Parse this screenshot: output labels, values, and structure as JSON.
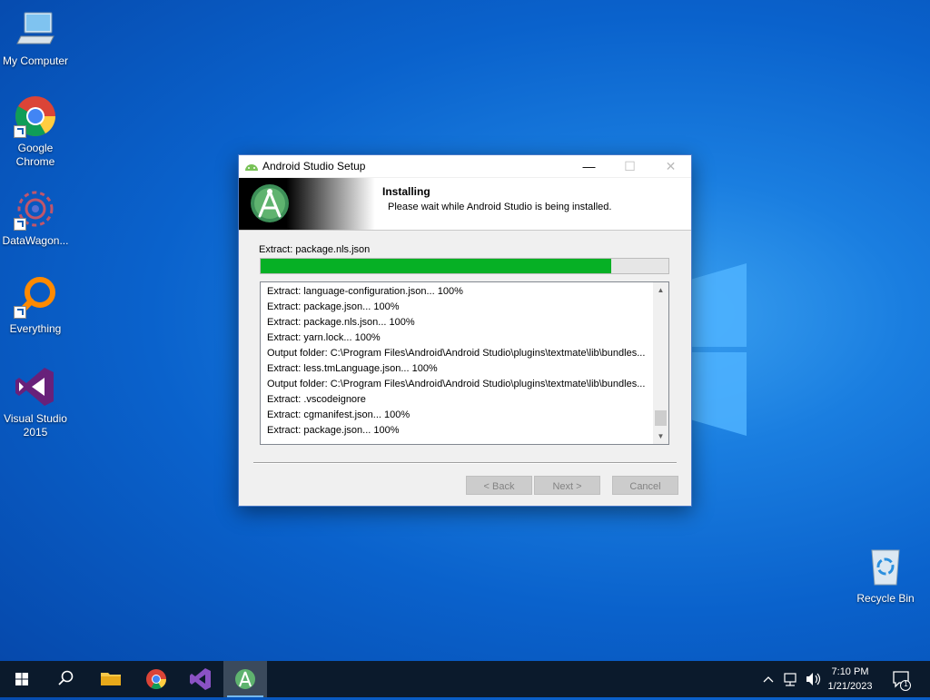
{
  "desktop": {
    "icons": [
      {
        "label": "My Computer"
      },
      {
        "label": "Google Chrome"
      },
      {
        "label": "DataWagon..."
      },
      {
        "label": "Everything"
      },
      {
        "label": "Visual Studio 2015"
      },
      {
        "label": "Recycle Bin"
      }
    ]
  },
  "dialog": {
    "title": "Android Studio Setup",
    "header_title": "Installing",
    "header_subtitle": "Please wait while Android Studio is being installed.",
    "status": "Extract: package.nls.json",
    "progress": 0.86,
    "log": [
      "Extract: language-configuration.json... 100%",
      "Extract: package.json... 100%",
      "Extract: package.nls.json... 100%",
      "Extract: yarn.lock... 100%",
      "Output folder: C:\\Program Files\\Android\\Android Studio\\plugins\\textmate\\lib\\bundles...",
      "Extract: less.tmLanguage.json... 100%",
      "Output folder: C:\\Program Files\\Android\\Android Studio\\plugins\\textmate\\lib\\bundles...",
      "Extract: .vscodeignore",
      "Extract: cgmanifest.json... 100%",
      "Extract: package.json... 100%"
    ],
    "buttons": {
      "back": "< Back",
      "next": "Next >",
      "cancel": "Cancel"
    }
  },
  "taskbar": {
    "items": [
      {
        "icon": "start-icon"
      },
      {
        "icon": "search-icon"
      },
      {
        "icon": "file-explorer-icon"
      },
      {
        "icon": "chrome-icon"
      },
      {
        "icon": "visual-studio-icon"
      },
      {
        "icon": "android-studio-icon"
      }
    ],
    "clock_time": "7:10 PM",
    "clock_date": "1/21/2023",
    "notification_count": "1"
  },
  "colors": {
    "progress_fill": "#06b025",
    "accent": "#0078d7"
  }
}
